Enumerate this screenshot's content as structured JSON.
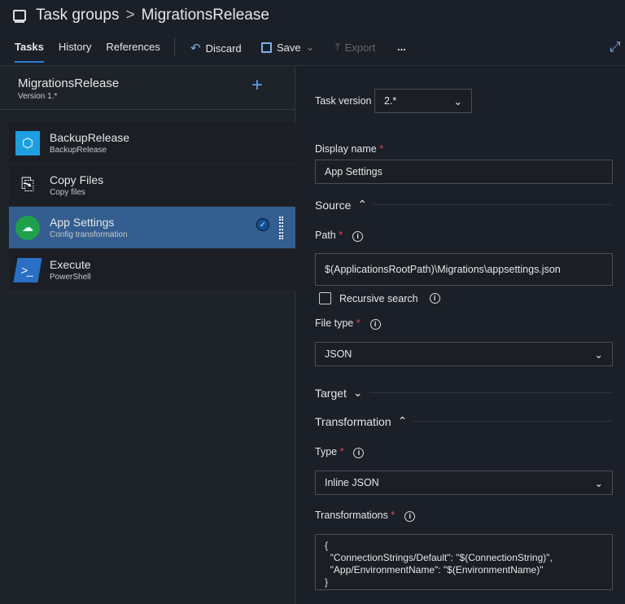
{
  "header": {
    "breadcrumb_root": "Task groups",
    "separator": ">",
    "title": "MigrationsRelease"
  },
  "tabs": [
    {
      "label": "Tasks",
      "active": true
    },
    {
      "label": "History"
    },
    {
      "label": "References"
    }
  ],
  "toolbar": {
    "discard": "Discard",
    "save": "Save",
    "export": "Export",
    "more": "..."
  },
  "group": {
    "name": "MigrationsRelease",
    "version": "Version 1.*"
  },
  "tasks": [
    {
      "name": "BackupRelease",
      "sub": "BackupRelease",
      "icon": "package-icon"
    },
    {
      "name": "Copy Files",
      "sub": "Copy files",
      "icon": "copy-files-icon"
    },
    {
      "name": "App Settings",
      "sub": "Config transformation",
      "icon": "cloud-gear-icon",
      "selected": true
    },
    {
      "name": "Execute",
      "sub": "PowerShell",
      "icon": "powershell-icon"
    }
  ],
  "form": {
    "task_version_label": "Task version",
    "task_version": "2.*",
    "display_name_label": "Display name",
    "display_name": "App Settings",
    "source": "Source",
    "path_label": "Path",
    "path": "$(ApplicationsRootPath)\\Migrations\\appsettings.json",
    "recursive_label": "Recursive search",
    "recursive": false,
    "file_type_label": "File type",
    "file_type": "JSON",
    "target": "Target",
    "transformation": "Transformation",
    "type_label": "Type",
    "type": "Inline JSON",
    "transformations_label": "Transformations",
    "transformations": "{\n  \"ConnectionStrings/Default\": \"$(ConnectionString)\",\n  \"App/EnvironmentName\": \"$(EnvironmentName)\"\n}",
    "required": "*",
    "info": "i"
  },
  "colors": {
    "accent": "#2e7bd6",
    "selected": "#345e90",
    "required": "#e04a4a"
  }
}
